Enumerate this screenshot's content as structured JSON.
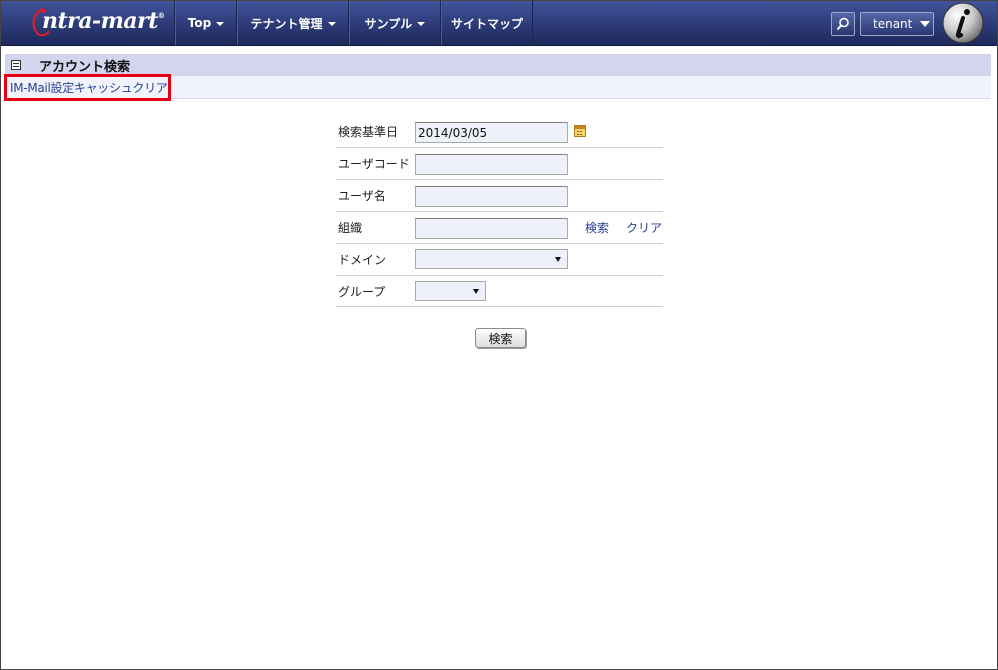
{
  "navbar": {
    "logo_text": "ntra-mart",
    "logo_mark": "®",
    "items": [
      {
        "label": "Top",
        "has_caret": true
      },
      {
        "label": "テナント管理",
        "has_caret": true
      },
      {
        "label": "サンプル",
        "has_caret": true
      },
      {
        "label": "サイトマップ",
        "has_caret": false
      }
    ],
    "search_icon": "search-icon",
    "user_label": "tenant"
  },
  "page": {
    "title": "アカウント検索",
    "cache_clear_link": "IM-Mail設定キャッシュクリア"
  },
  "form": {
    "rows": [
      {
        "label": "検索基準日",
        "type": "date",
        "value": "2014/03/05"
      },
      {
        "label": "ユーザコード",
        "type": "text",
        "value": ""
      },
      {
        "label": "ユーザ名",
        "type": "text",
        "value": ""
      },
      {
        "label": "組織",
        "type": "text",
        "value": "",
        "search_link": "検索",
        "clear_link": "クリア"
      },
      {
        "label": "ドメイン",
        "type": "select",
        "value": ""
      },
      {
        "label": "グループ",
        "type": "select",
        "value": ""
      }
    ],
    "submit_label": "検索"
  },
  "colors": {
    "navbar": "#2c3a76",
    "title_bar": "#d3d4ee",
    "link": "#2a3f8f",
    "highlight": "#e60012"
  }
}
